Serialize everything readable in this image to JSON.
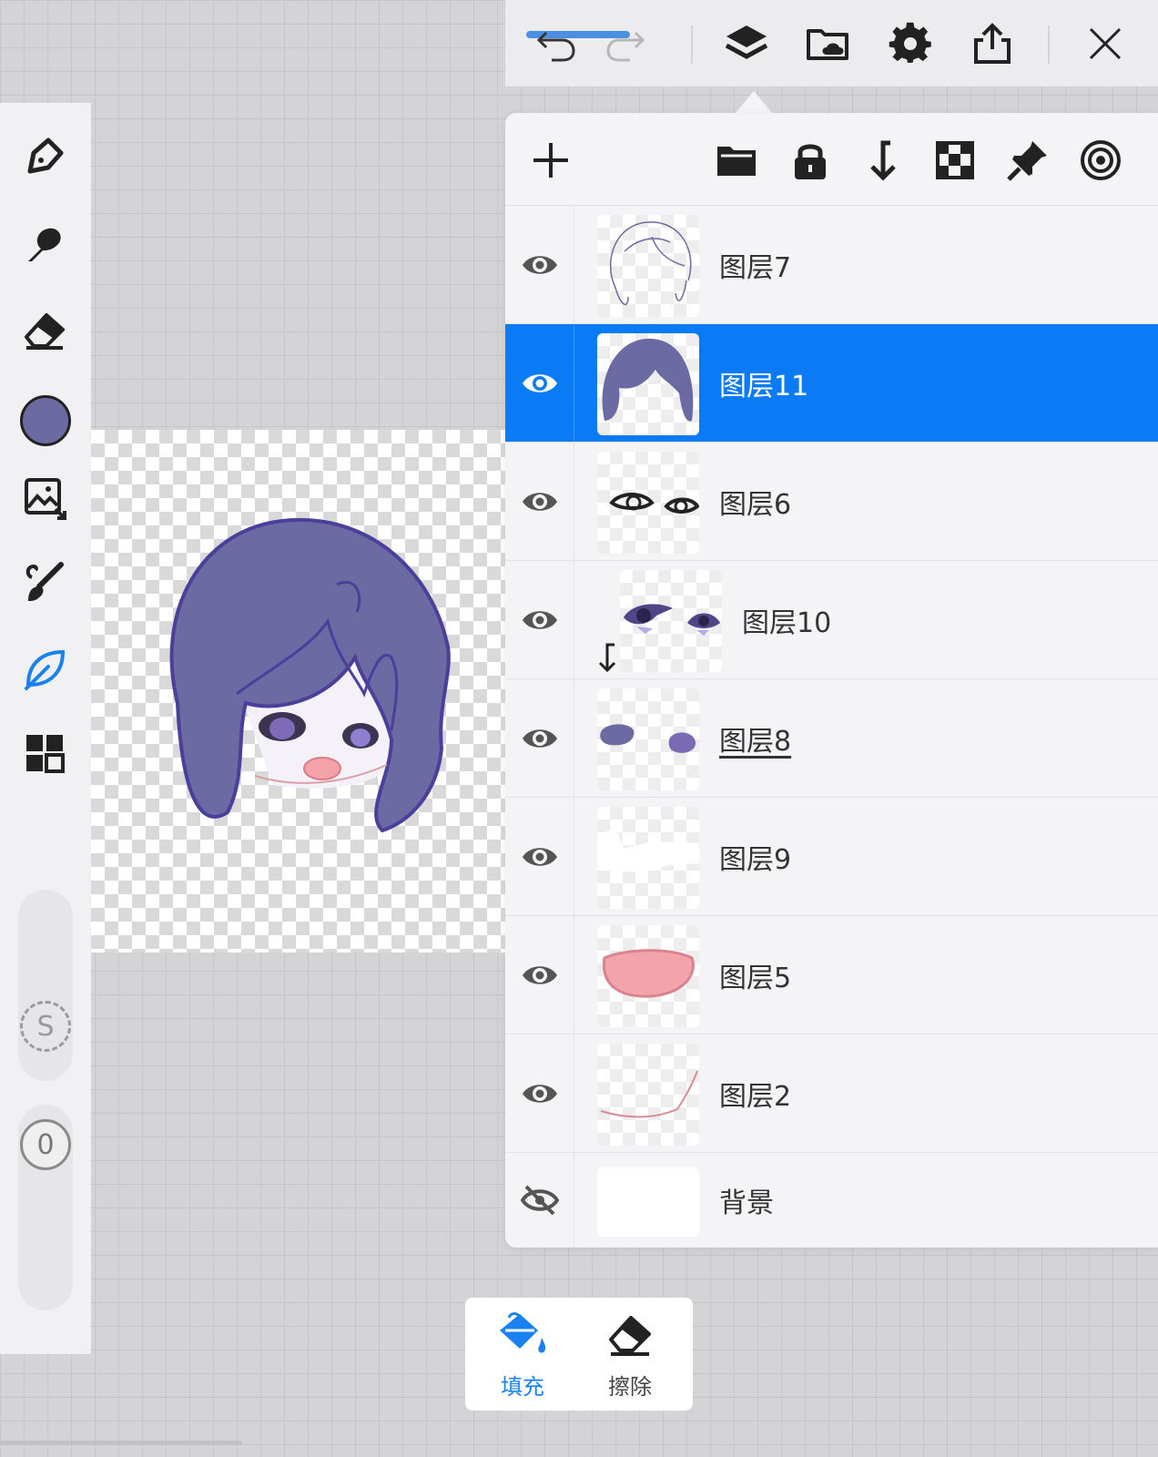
{
  "colors": {
    "accent": "#0a7bf5",
    "current_color": "#6b6aa3",
    "fill_active": "#1a82f0"
  },
  "sidebar": {
    "tools": [
      {
        "name": "pen-icon"
      },
      {
        "name": "smudge-icon"
      },
      {
        "name": "eraser-icon"
      },
      {
        "name": "color-swatch"
      },
      {
        "name": "image-import-icon"
      },
      {
        "name": "brush-settings-icon"
      },
      {
        "name": "leaf-icon"
      },
      {
        "name": "gallery-grid-icon"
      }
    ],
    "size_label": "S",
    "opacity_label": "0"
  },
  "topbar": {
    "buttons": [
      "undo-icon",
      "redo-icon",
      "layers-icon",
      "cloud-folder-icon",
      "gear-icon",
      "share-icon",
      "close-icon"
    ]
  },
  "layers_panel": {
    "header_buttons": [
      "add-icon",
      "folder-icon",
      "lock-icon",
      "clip-down-icon",
      "transparency-icon",
      "pin-icon",
      "target-icon"
    ],
    "layers": [
      {
        "name": "图层7",
        "visible": true
      },
      {
        "name": "图层11",
        "visible": true,
        "selected": true
      },
      {
        "name": "图层6",
        "visible": true
      },
      {
        "name": "图层10",
        "visible": true,
        "clipped": true
      },
      {
        "name": "图层8",
        "visible": true
      },
      {
        "name": "图层9",
        "visible": true
      },
      {
        "name": "图层5",
        "visible": true
      },
      {
        "name": "图层2",
        "visible": true
      },
      {
        "name": "背景",
        "visible": false
      }
    ]
  },
  "fill_tools": {
    "fill_label": "填充",
    "erase_label": "擦除",
    "active": "fill"
  }
}
